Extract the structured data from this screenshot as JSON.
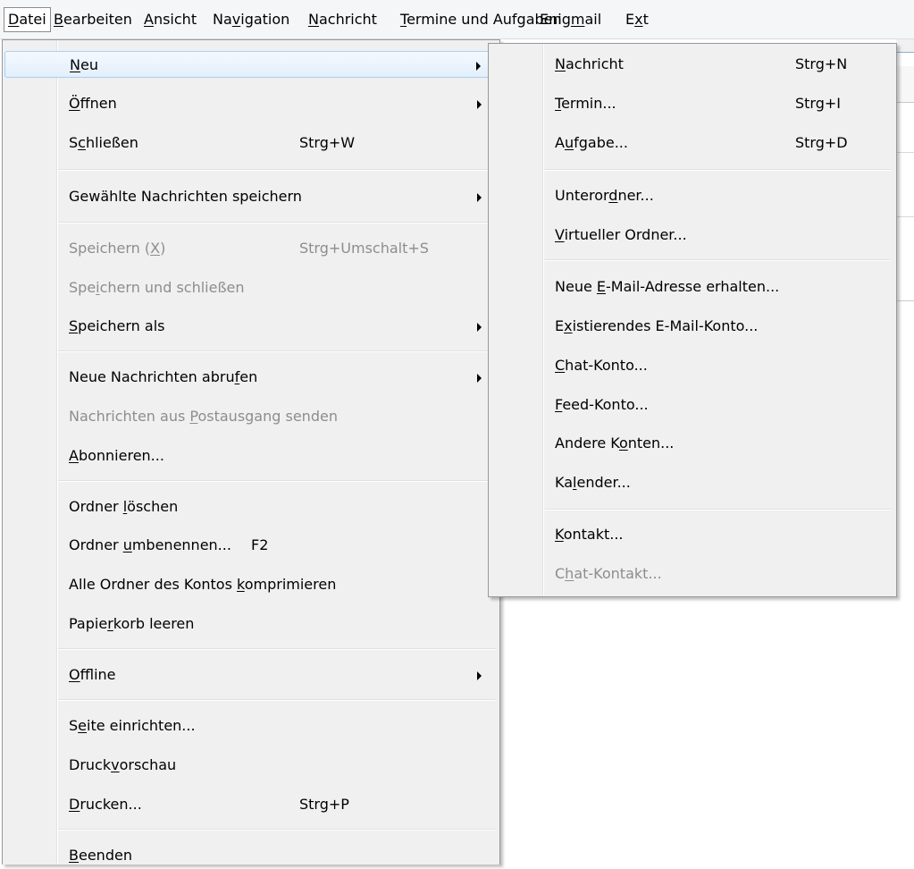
{
  "menubar": {
    "items": [
      {
        "pre": "",
        "u": "D",
        "post": "atei"
      },
      {
        "pre": "",
        "u": "B",
        "post": "earbeiten"
      },
      {
        "pre": "",
        "u": "A",
        "post": "nsicht"
      },
      {
        "pre": "Na",
        "u": "v",
        "post": "igation"
      },
      {
        "pre": "",
        "u": "N",
        "post": "achricht"
      },
      {
        "pre": "",
        "u": "T",
        "post": "ermine und Aufgaben"
      },
      {
        "pre": "Enig",
        "u": "m",
        "post": "ail"
      },
      {
        "pre": "E",
        "u": "x",
        "post": "t"
      }
    ]
  },
  "file_menu": {
    "items": [
      {
        "pre": "",
        "u": "N",
        "post": "eu",
        "shortcut": ""
      },
      {
        "pre": "",
        "u": "Ö",
        "post": "ffnen",
        "shortcut": ""
      },
      {
        "pre": "S",
        "u": "c",
        "post": "hließen",
        "shortcut": "Strg+W"
      },
      {
        "pre": "Gewählte Nachrichten speichern",
        "u": "",
        "post": "",
        "shortcut": ""
      },
      {
        "pre": "Speichern (",
        "u": "X",
        "post": ")",
        "shortcut": "Strg+Umschalt+S"
      },
      {
        "pre": "Spe",
        "u": "i",
        "post": "chern und schließen",
        "shortcut": ""
      },
      {
        "pre": "",
        "u": "S",
        "post": "peichern als",
        "shortcut": ""
      },
      {
        "pre": "Neue Nachrichten abru",
        "u": "f",
        "post": "en",
        "shortcut": ""
      },
      {
        "pre": "Nachrichten aus ",
        "u": "P",
        "post": "ostausgang senden",
        "shortcut": ""
      },
      {
        "pre": "",
        "u": "A",
        "post": "bonnieren...",
        "shortcut": ""
      },
      {
        "pre": "Ordner ",
        "u": "l",
        "post": "öschen",
        "shortcut": ""
      },
      {
        "pre": "Ordner ",
        "u": "u",
        "post": "mbenennen...",
        "shortcut": "F2"
      },
      {
        "pre": "Alle Ordner des Kontos ",
        "u": "k",
        "post": "omprimieren",
        "shortcut": ""
      },
      {
        "pre": "Papie",
        "u": "r",
        "post": "korb leeren",
        "shortcut": ""
      },
      {
        "pre": "",
        "u": "O",
        "post": "ffline",
        "shortcut": ""
      },
      {
        "pre": "S",
        "u": "e",
        "post": "ite einrichten...",
        "shortcut": ""
      },
      {
        "pre": "Druck",
        "u": "v",
        "post": "orschau",
        "shortcut": ""
      },
      {
        "pre": "",
        "u": "D",
        "post": "rucken...",
        "shortcut": "Strg+P"
      },
      {
        "pre": "",
        "u": "B",
        "post": "eenden",
        "shortcut": ""
      }
    ]
  },
  "new_submenu": {
    "items": [
      {
        "pre": "",
        "u": "N",
        "post": "achricht",
        "shortcut": "Strg+N"
      },
      {
        "pre": "",
        "u": "T",
        "post": "ermin...",
        "shortcut": "Strg+I"
      },
      {
        "pre": "A",
        "u": "u",
        "post": "fgabe...",
        "shortcut": "Strg+D"
      },
      {
        "pre": "Unteror",
        "u": "d",
        "post": "ner...",
        "shortcut": ""
      },
      {
        "pre": "",
        "u": "V",
        "post": "irtueller Ordner...",
        "shortcut": ""
      },
      {
        "pre": "Neue ",
        "u": "E",
        "post": "-Mail-Adresse erhalten...",
        "shortcut": ""
      },
      {
        "pre": "E",
        "u": "x",
        "post": "istierendes E-Mail-Konto...",
        "shortcut": ""
      },
      {
        "pre": "",
        "u": "C",
        "post": "hat-Konto...",
        "shortcut": ""
      },
      {
        "pre": "",
        "u": "F",
        "post": "eed-Konto...",
        "shortcut": ""
      },
      {
        "pre": "Andere K",
        "u": "o",
        "post": "nten...",
        "shortcut": ""
      },
      {
        "pre": "Ka",
        "u": "l",
        "post": "ender...",
        "shortcut": ""
      },
      {
        "pre": "",
        "u": "K",
        "post": "ontakt...",
        "shortcut": ""
      },
      {
        "pre": "C",
        "u": "h",
        "post": "at-Kontakt...",
        "shortcut": ""
      }
    ]
  }
}
